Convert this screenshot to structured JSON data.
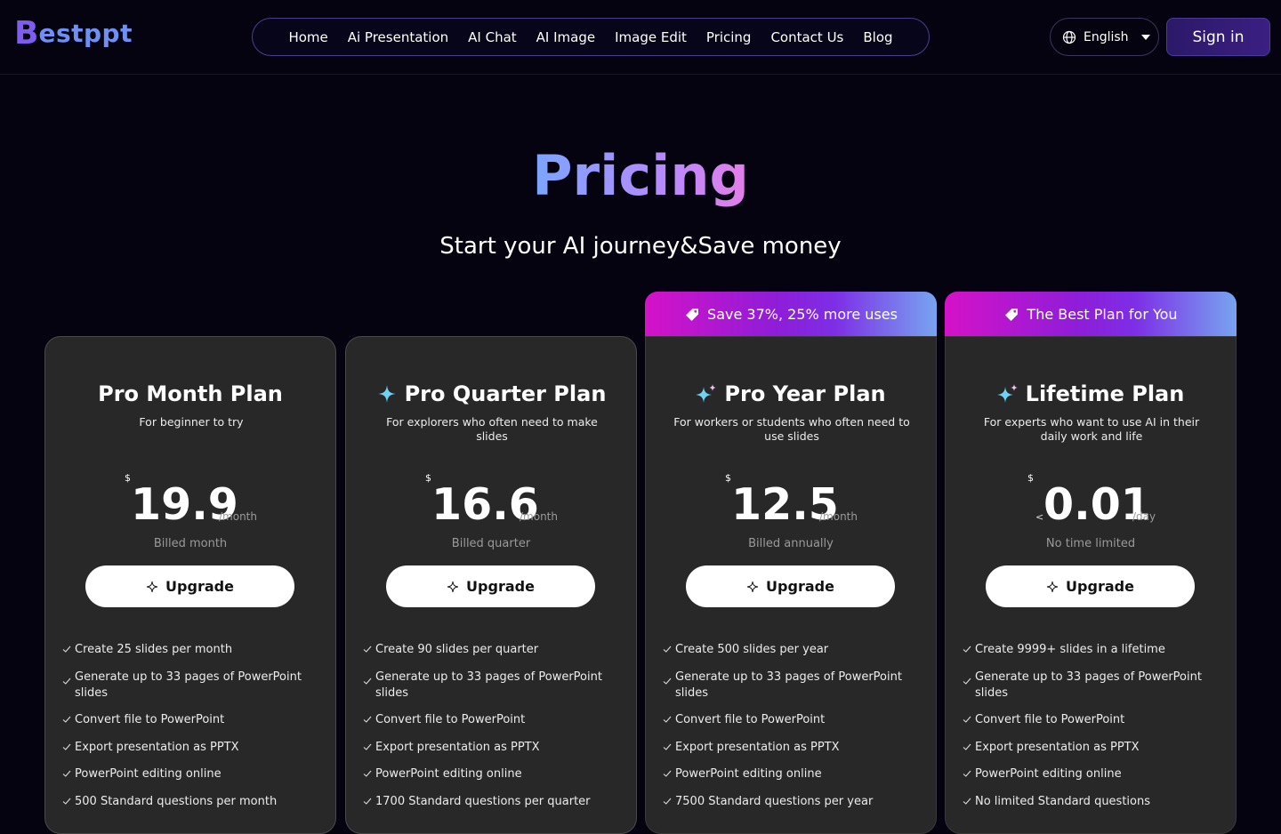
{
  "header": {
    "logo_initial": "B",
    "logo_rest": "estppt",
    "nav": [
      "Home",
      "Ai Presentation",
      "AI Chat",
      "AI Image",
      "Image Edit",
      "Pricing",
      "Contact Us",
      "Blog"
    ],
    "language": "English",
    "sign_in": "Sign in"
  },
  "hero": {
    "title": "Pricing",
    "subtitle": "Start your AI journey&Save money"
  },
  "colors": {
    "background": "#05030f",
    "card": "#282828",
    "accent_pink": "#d512c8",
    "accent_purple": "#7d2ee6",
    "accent_blue": "#78a4f0",
    "title_gradient_start": "#7aa6ff",
    "title_gradient_end": "#e47ee8"
  },
  "plans": [
    {
      "name": "Pro Month Plan",
      "icon": "none",
      "description": "For beginner to try",
      "currency": "$",
      "prefix": "",
      "amount": "19.9",
      "period": "/month",
      "billing": "Billed month",
      "button": "Upgrade",
      "ribbon": "",
      "features": [
        "Create 25 slides per month",
        "Generate up to 33 pages of PowerPoint slides",
        "Convert file to PowerPoint",
        "Export presentation as PPTX",
        "PowerPoint editing online",
        "500 Standard questions per month"
      ]
    },
    {
      "name": "Pro Quarter Plan",
      "icon": "sparkle-icon",
      "description": "For explorers who often need to make slides",
      "currency": "$",
      "prefix": "",
      "amount": "16.6",
      "period": "/month",
      "billing": "Billed quarter",
      "button": "Upgrade",
      "ribbon": "",
      "features": [
        "Create 90 slides per quarter",
        "Generate up to 33 pages of PowerPoint slides",
        "Convert file to PowerPoint",
        "Export presentation as PPTX",
        "PowerPoint editing online",
        "1700 Standard questions per quarter"
      ]
    },
    {
      "name": "Pro Year Plan",
      "icon": "sparkles-icon",
      "description": "For workers or students who often need to use slides",
      "currency": "$",
      "prefix": "",
      "amount": "12.5",
      "period": "/month",
      "billing": "Billed annually",
      "button": "Upgrade",
      "ribbon": "Save 37%, 25% more uses",
      "features": [
        "Create 500 slides per year",
        "Generate up to 33 pages of PowerPoint slides",
        "Convert file to PowerPoint",
        "Export presentation as PPTX",
        "PowerPoint editing online",
        "7500 Standard questions per year"
      ]
    },
    {
      "name": "Lifetime Plan",
      "icon": "sparkles-icon",
      "description": "For experts who want to use AI in their daily work and life",
      "currency": "$",
      "prefix": "<",
      "amount": "0.01",
      "period": "/day",
      "billing": "No time limited",
      "button": "Upgrade",
      "ribbon": "The Best Plan for You",
      "features": [
        "Create 9999+ slides in a lifetime",
        "Generate up to 33 pages of PowerPoint slides",
        "Convert file to PowerPoint",
        "Export presentation as PPTX",
        "PowerPoint editing online",
        "No limited Standard questions"
      ]
    }
  ]
}
